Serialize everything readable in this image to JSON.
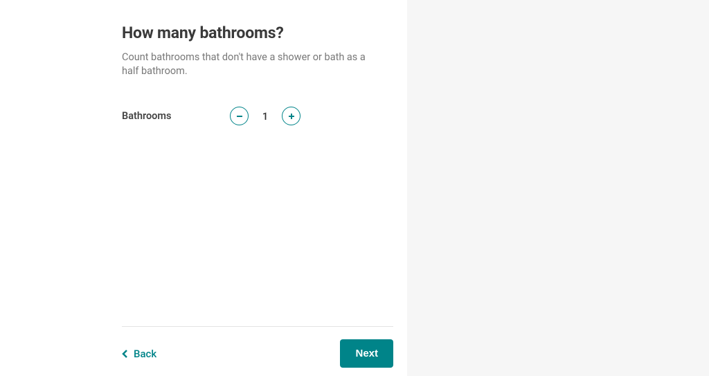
{
  "page": {
    "title": "How many bathrooms?",
    "subtitle": "Count bathrooms that don't have a shower or bath as a half bathroom."
  },
  "stepper": {
    "label": "Bathrooms",
    "value": "1"
  },
  "footer": {
    "back_label": "Back",
    "next_label": "Next"
  }
}
